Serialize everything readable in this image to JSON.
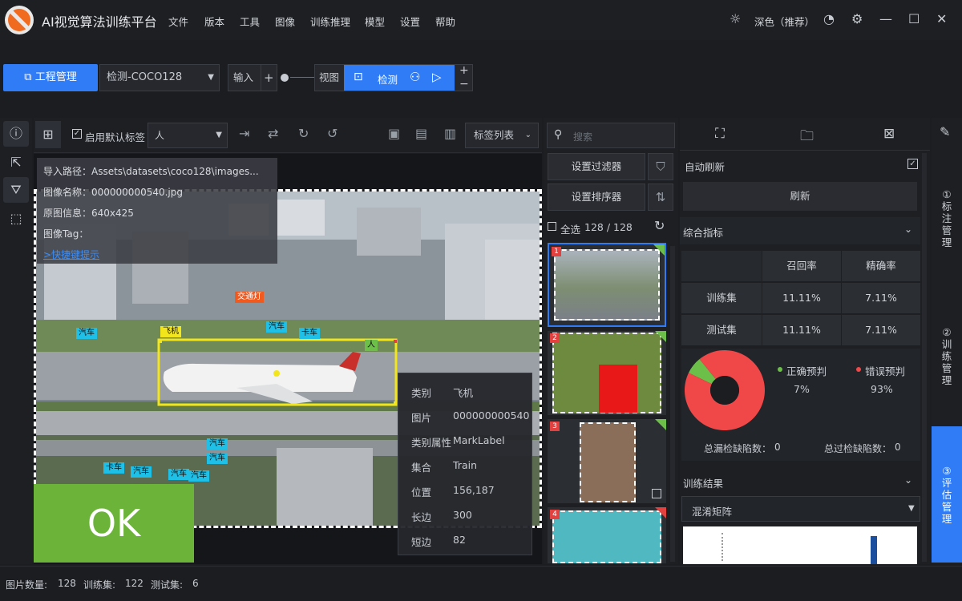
{
  "app": {
    "title": "AI视觉算法训练平台",
    "menus": [
      "文件",
      "版本",
      "工具",
      "图像",
      "训练推理",
      "模型",
      "设置",
      "帮助"
    ],
    "theme": "深色（推荐）"
  },
  "projbar": {
    "project_button": "工程管理",
    "dataset": "检测-COCO128",
    "input_label": "输入",
    "view_label": "视图",
    "detect_label": "检测",
    "plus": "+",
    "minus": "−"
  },
  "imgtool": {
    "default_label_check": "启用默认标签",
    "label_value": "人",
    "label_list": "标签列表"
  },
  "info": {
    "import_path": "导入路径：Assets\\datasets\\coco128\\images...",
    "image_name": "图像名称：000000000540.jpg",
    "image_info": "原图信息：640x425",
    "image_tag": "图像Tag：",
    "shortcut_link": ">快捷键提示"
  },
  "canvas_tags": {
    "airplane": "飞机",
    "traffic_light": "交通灯",
    "car": "汽车",
    "truck": "卡车",
    "person": "人"
  },
  "ok_label": "OK",
  "detail": {
    "rows": [
      {
        "k": "类别",
        "v": "飞机"
      },
      {
        "k": "图片",
        "v": "000000000540"
      },
      {
        "k": "类别属性",
        "v": "MarkLabel"
      },
      {
        "k": "集合",
        "v": "Train"
      },
      {
        "k": "位置",
        "v": "156,187"
      },
      {
        "k": "长边",
        "v": "300"
      },
      {
        "k": "短边",
        "v": "82"
      }
    ]
  },
  "thumbpanel": {
    "search_placeholder": "搜索",
    "filter_btn": "设置过滤器",
    "sort_btn": "设置排序器",
    "select_all": "全选",
    "count": "128 / 128",
    "thumbs": [
      {
        "num": "1",
        "corner": "#6cc04a"
      },
      {
        "num": "2",
        "corner": "#6cc04a"
      },
      {
        "num": "3",
        "corner": "#6cc04a"
      },
      {
        "num": "4",
        "corner": "#e34040"
      }
    ]
  },
  "rightpanel": {
    "auto_refresh": "自动刷新",
    "refresh": "刷新",
    "metrics_title": "综合指标",
    "headers": [
      "召回率",
      "精确率"
    ],
    "rows": [
      {
        "name": "训练集",
        "recall": "11.11%",
        "precision": "7.11%"
      },
      {
        "name": "测试集",
        "recall": "11.11%",
        "precision": "7.11%"
      }
    ],
    "legend_correct": "正确预判",
    "legend_wrong": "错误预判",
    "pct_correct": "7%",
    "pct_wrong": "93%",
    "miss_label": "总漏检缺陷数：",
    "miss_value": "0",
    "over_label": "总过检缺陷数：",
    "over_value": "0",
    "train_result": "训练结果",
    "confusion": "混淆矩阵",
    "colors": {
      "correct": "#6cc04a",
      "wrong": "#f04848"
    }
  },
  "chart_data": {
    "type": "pie",
    "categories": [
      "正确预判",
      "错误预判"
    ],
    "values": [
      7,
      93
    ]
  },
  "vtabs": {
    "tab1": "①标注管理",
    "tab2": "②训练管理",
    "tab3": "③评估管理"
  },
  "status": {
    "image_count_label": "图片数量:",
    "image_count": "128",
    "train_label": "训练集:",
    "train_count": "122",
    "test_label": "测试集:",
    "test_count": "6"
  }
}
